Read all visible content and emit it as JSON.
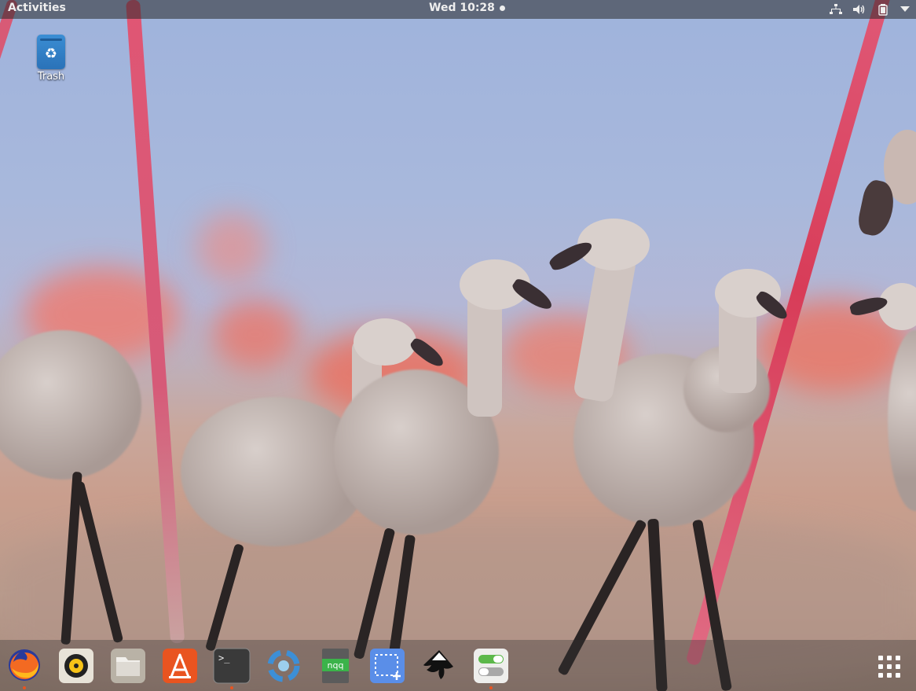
{
  "topbar": {
    "activities": "Activities",
    "clock": "Wed 10:28",
    "tray_icons": [
      "network-icon",
      "volume-icon",
      "battery-icon",
      "system-menu-arrow-icon"
    ]
  },
  "desktop": {
    "icons": [
      {
        "label": "Trash",
        "icon": "trash-icon"
      }
    ]
  },
  "dock": {
    "apps": [
      {
        "name": "Firefox",
        "icon": "firefox-icon",
        "running": true
      },
      {
        "name": "Rhythmbox",
        "icon": "rhythmbox-icon",
        "running": false
      },
      {
        "name": "Files",
        "icon": "files-icon",
        "running": false
      },
      {
        "name": "Ubuntu Software",
        "icon": "software-icon",
        "running": false
      },
      {
        "name": "Terminal",
        "icon": "terminal-icon",
        "running": true,
        "glyph": ">_"
      },
      {
        "name": "Shotwell",
        "icon": "shotwell-icon",
        "running": false
      },
      {
        "name": "nqq",
        "icon": "notepadqq-icon",
        "running": false,
        "glyph": "nqq"
      },
      {
        "name": "Screenshot",
        "icon": "screenshot-icon",
        "running": false
      },
      {
        "name": "Inkscape",
        "icon": "inkscape-icon",
        "running": false
      },
      {
        "name": "Tweaks",
        "icon": "tweaks-icon",
        "running": true
      }
    ],
    "show_apps_icon": "show-applications-icon"
  },
  "colors": {
    "accent": "#e95420",
    "topbar_bg": "#282828",
    "trash_blue": "#2a72b8"
  }
}
